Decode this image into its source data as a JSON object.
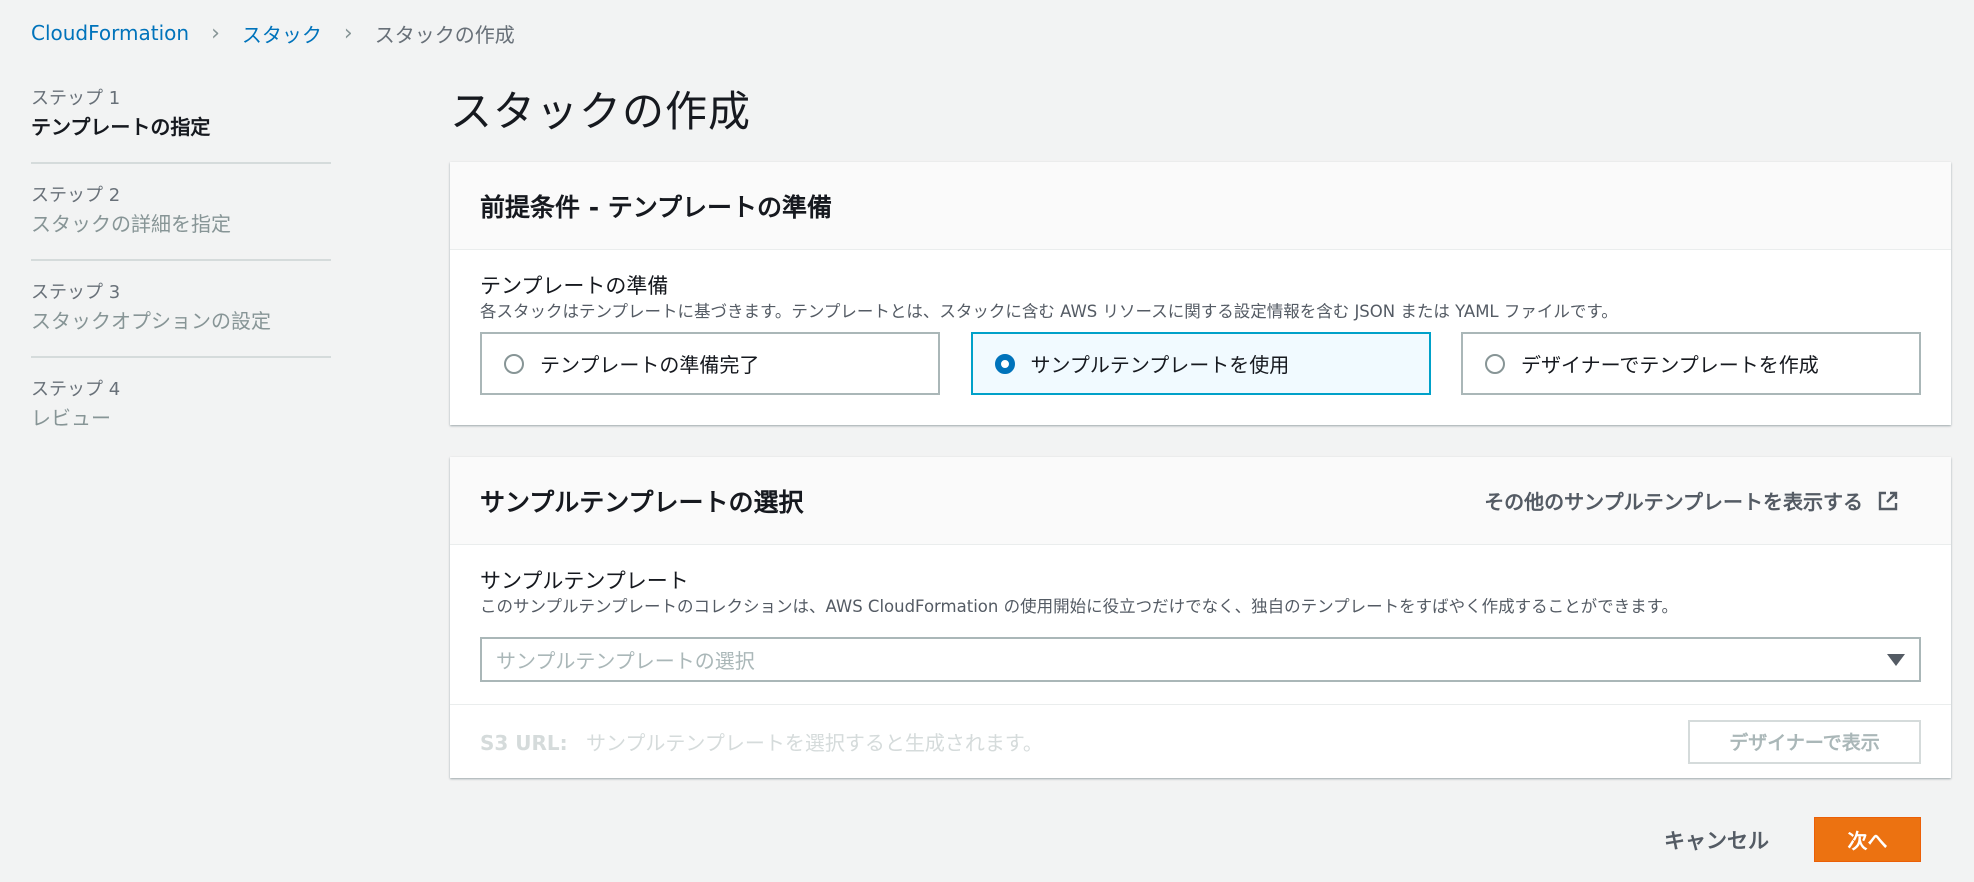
{
  "breadcrumb": [
    "CloudFormation",
    "スタック",
    "スタックの作成"
  ],
  "steps": [
    {
      "num": "ステップ 1",
      "title": "テンプレートの指定",
      "active": true
    },
    {
      "num": "ステップ 2",
      "title": "スタックの詳細を指定",
      "active": false
    },
    {
      "num": "ステップ 3",
      "title": "スタックオプションの設定",
      "active": false
    },
    {
      "num": "ステップ 4",
      "title": "レビュー",
      "active": false
    }
  ],
  "page_title": "スタックの作成",
  "prereq": {
    "header": "前提条件 - テンプレートの準備",
    "label": "テンプレートの準備",
    "description": "各スタックはテンプレートに基づきます。テンプレートとは、スタックに含む AWS リソースに関する設定情報を含む JSON または YAML ファイルです。",
    "options": [
      {
        "label": "テンプレートの準備完了",
        "selected": false
      },
      {
        "label": "サンプルテンプレートを使用",
        "selected": true
      },
      {
        "label": "デザイナーでテンプレートを作成",
        "selected": false
      }
    ]
  },
  "sample": {
    "header": "サンプルテンプレートの選択",
    "more_link": "その他のサンプルテンプレートを表示する",
    "label": "サンプルテンプレート",
    "description": "このサンプルテンプレートのコレクションは、AWS CloudFormation の使用開始に役立つだけでなく、独自のテンプレートをすばやく作成することができます。",
    "select_placeholder": "サンプルテンプレートの選択",
    "s3_label": "S3 URL:",
    "s3_value": "サンプルテンプレートを選択すると生成されます。",
    "designer_button": "デザイナーで表示"
  },
  "actions": {
    "cancel": "キャンセル",
    "next": "次へ"
  },
  "colors": {
    "link": "#0073bb",
    "primary": "#ec7211",
    "selected_border": "#00a1c9",
    "background": "#f2f3f3"
  }
}
